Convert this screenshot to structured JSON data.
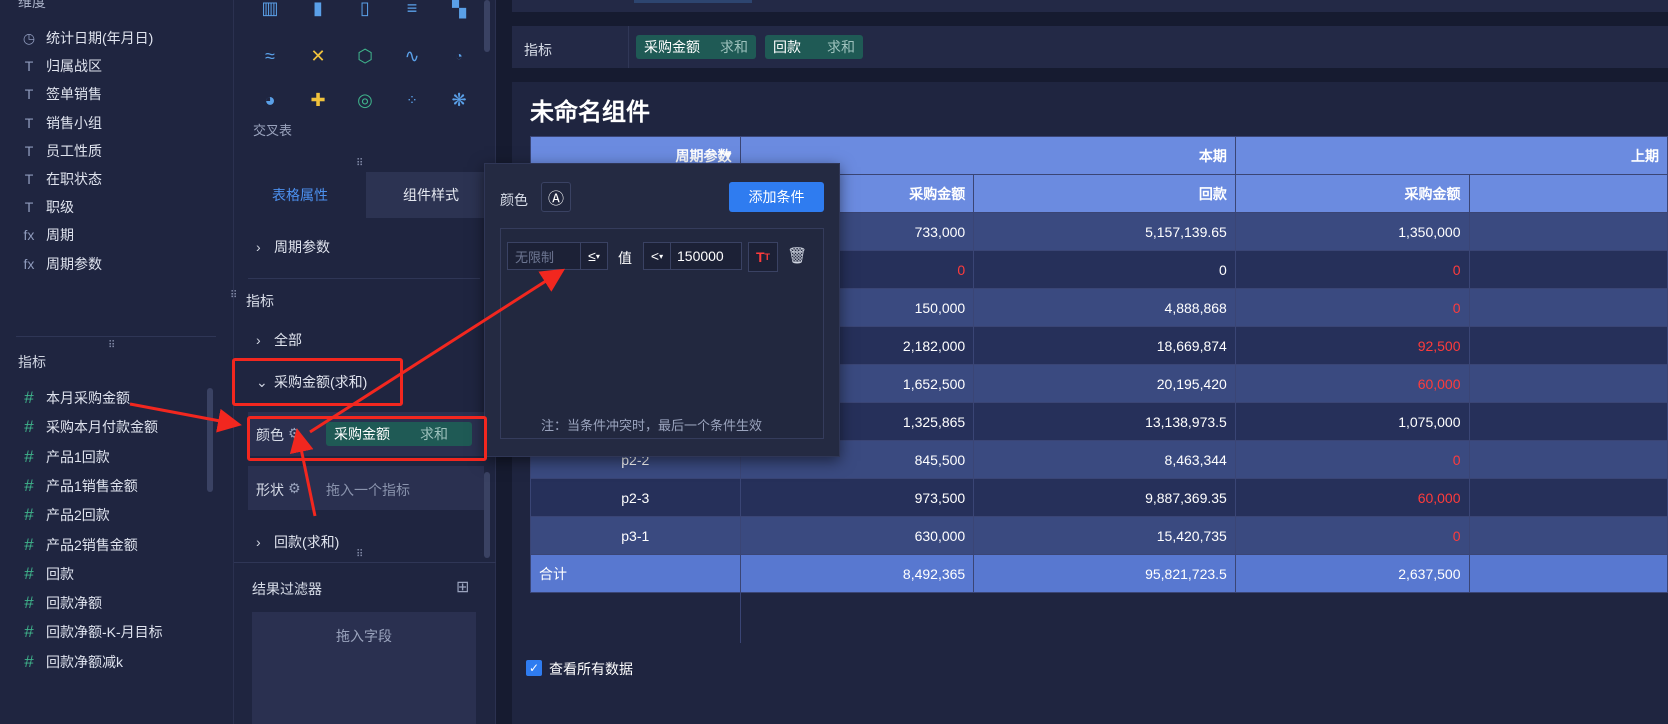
{
  "dimension_section": {
    "title": "维度",
    "items": [
      {
        "icon": "clock-icon",
        "glyph": "◷",
        "label": "统计日期(年月日)"
      },
      {
        "icon": "text-type-icon",
        "glyph": "T",
        "label": "归属战区"
      },
      {
        "icon": "text-type-icon",
        "glyph": "T",
        "label": "签单销售"
      },
      {
        "icon": "text-type-icon",
        "glyph": "T",
        "label": "销售小组"
      },
      {
        "icon": "text-type-icon",
        "glyph": "T",
        "label": "员工性质"
      },
      {
        "icon": "text-type-icon",
        "glyph": "T",
        "label": "在职状态"
      },
      {
        "icon": "text-type-icon",
        "glyph": "T",
        "label": "职级"
      },
      {
        "icon": "formula-icon",
        "glyph": "fx",
        "label": "周期"
      },
      {
        "icon": "formula-icon",
        "glyph": "fx",
        "label": "周期参数"
      }
    ]
  },
  "measure_section": {
    "title": "指标",
    "items": [
      "本月采购金额",
      "采购本月付款金额",
      "产品1回款",
      "产品1销售金额",
      "产品2回款",
      "产品2销售金额",
      "回款",
      "回款净额",
      "回款净额-K-月目标",
      "回款净额减k"
    ]
  },
  "chart_types": {
    "crosstab_label": "交叉表"
  },
  "mid_panel": {
    "tab_table_attr": "表格属性",
    "tab_component_style": "组件样式",
    "period_param": "周期参数",
    "indicator_title": "指标",
    "all": "全部",
    "measure_expanded": "采购金额(求和)",
    "color_label": "颜色",
    "color_tag_name": "采购金额",
    "color_tag_agg": "求和",
    "shape_label": "形状",
    "shape_placeholder": "拖入一个指标",
    "measure_collapsed": "回款(求和)",
    "result_filter": "结果过滤器",
    "drop_field": "拖入字段"
  },
  "popup": {
    "color_label": "颜色",
    "add_condition": "添加条件",
    "min_placeholder": "无限制",
    "op1": "≤",
    "value_label": "值",
    "op2": "<",
    "value": "150000",
    "note": "注：当条件冲突时，最后一个条件生效"
  },
  "right_panel": {
    "indicator_label": "指标",
    "tag1_name": "采购金额",
    "tag1_agg": "求和",
    "tag2_name": "回款",
    "tag2_agg": "求和",
    "component_title": "未命名组件",
    "view_all": "查看所有数据"
  },
  "table": {
    "header1": {
      "c0": "周期参数",
      "c1": "本期",
      "c2": "上期"
    },
    "header2": {
      "c1": "采购金额",
      "c2": "回款",
      "c3": "采购金额"
    },
    "rows": [
      {
        "name": "",
        "a": "733,000",
        "b": "5,157,139.65",
        "c": "1,350,000",
        "a_neg": false,
        "c_neg": false
      },
      {
        "name": "",
        "a": "0",
        "b": "0",
        "c": "0",
        "a_neg": true,
        "c_neg": true
      },
      {
        "name": "",
        "a": "150,000",
        "b": "4,888,868",
        "c": "0",
        "a_neg": false,
        "c_neg": true
      },
      {
        "name": "",
        "a": "2,182,000",
        "b": "18,669,874",
        "c": "92,500",
        "a_neg": false,
        "c_neg": true
      },
      {
        "name": "",
        "a": "1,652,500",
        "b": "20,195,420",
        "c": "60,000",
        "a_neg": false,
        "c_neg": true
      },
      {
        "name": "",
        "a": "1,325,865",
        "b": "13,138,973.5",
        "c": "1,075,000",
        "a_neg": false,
        "c_neg": false
      },
      {
        "name": "p2-2",
        "a": "845,500",
        "b": "8,463,344",
        "c": "0",
        "a_neg": false,
        "c_neg": true
      },
      {
        "name": "p2-3",
        "a": "973,500",
        "b": "9,887,369.35",
        "c": "60,000",
        "a_neg": false,
        "c_neg": true
      },
      {
        "name": "p3-1",
        "a": "630,000",
        "b": "15,420,735",
        "c": "0",
        "a_neg": false,
        "c_neg": true
      }
    ],
    "total": {
      "name": "合计",
      "a": "8,492,365",
      "b": "95,821,723.5",
      "c": "2,637,500"
    }
  },
  "colors": {
    "accent": "#2f7cf0",
    "annotation": "#f2271f",
    "negative": "#ff3b3b",
    "teal_tag": "#1f5a55"
  }
}
